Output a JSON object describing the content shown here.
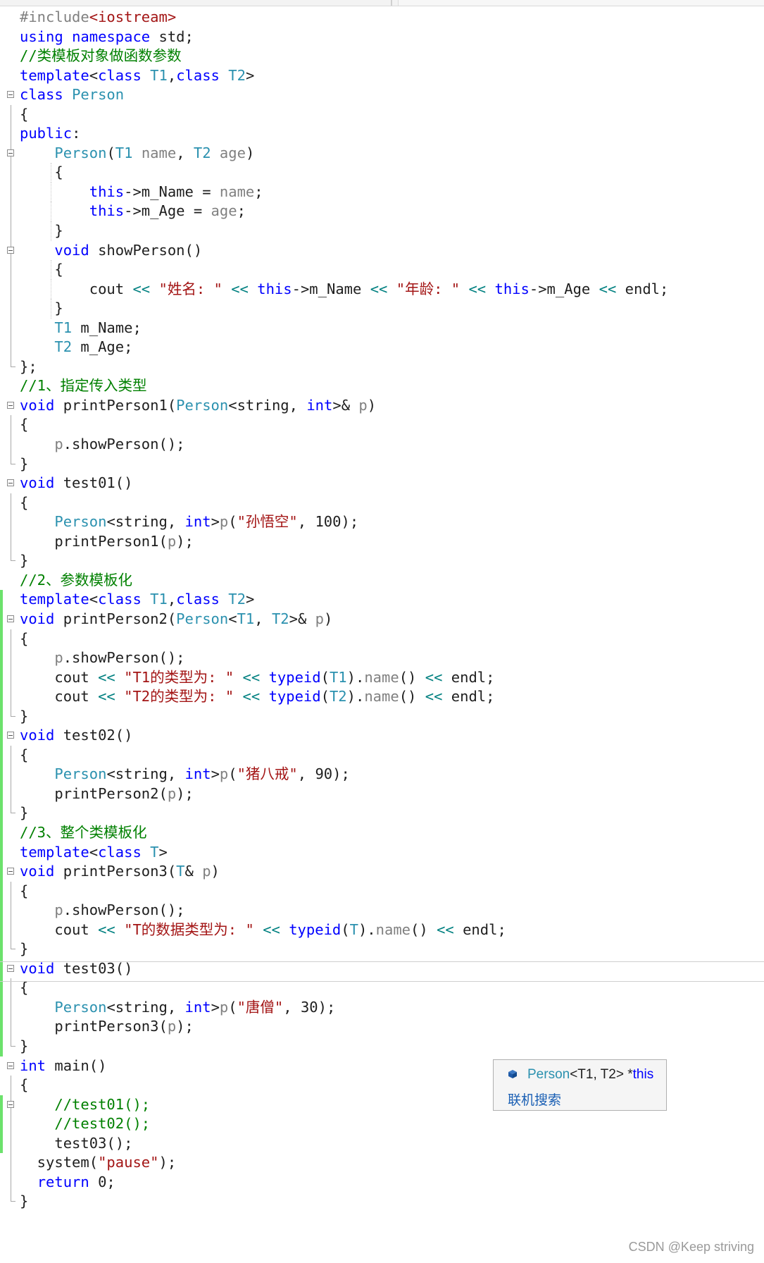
{
  "topbar": {
    "left_text": "",
    "right_text": ""
  },
  "code_lines": [
    "#include<iostream>",
    "using namespace std;",
    "//类模板对象做函数参数",
    "template<class T1,class T2>",
    "class Person",
    "{",
    "public:",
    "    Person(T1 name, T2 age)",
    "    {",
    "        this->m_Name = name;",
    "        this->m_Age = age;",
    "    }",
    "    void showPerson()",
    "    {",
    "        cout << \"姓名: \" << this->m_Name << \"年龄: \" << this->m_Age << endl;",
    "    }",
    "    T1 m_Name;",
    "    T2 m_Age;",
    "};",
    "//1、指定传入类型",
    "void printPerson1(Person<string, int>& p)",
    "{",
    "    p.showPerson();",
    "}",
    "void test01()",
    "{",
    "    Person<string, int>p(\"孙悟空\", 100);",
    "    printPerson1(p);",
    "}",
    "//2、参数模板化",
    "template<class T1,class T2>",
    "void printPerson2(Person<T1, T2>& p)",
    "{",
    "    p.showPerson();",
    "    cout << \"T1的类型为: \" << typeid(T1).name() << endl;",
    "    cout << \"T2的类型为: \" << typeid(T2).name() << endl;",
    "}",
    "void test02()",
    "{",
    "    Person<string, int>p(\"猪八戒\", 90);",
    "    printPerson2(p);",
    "}",
    "//3、整个类模板化",
    "template<class T>",
    "void printPerson3(T& p)",
    "{",
    "    p.showPerson();",
    "    cout << \"T的数据类型为: \" << typeid(T).name() << endl;",
    "}",
    "void test03()",
    "{",
    "    Person<string, int>p(\"唐僧\", 30);",
    "    printPerson3(p);",
    "}",
    "int main()",
    "{",
    "    //test01();",
    "    //test02();",
    "    test03();",
    "  system(\"pause\");",
    "  return 0;",
    "}"
  ],
  "tooltip": {
    "type_name": "Person",
    "type_args": "<T1, T2>",
    "pointer": "*",
    "this_kw": "this",
    "online_search": "联机搜索",
    "icon": "class-cube-icon",
    "icon_color": "#1e5aa8"
  },
  "watermark": "CSDN @Keep striving",
  "colors": {
    "keyword": "#0000ff",
    "type": "#2b91af",
    "comment": "#008000",
    "string": "#a31515",
    "change_bar": "#6ce26c"
  }
}
